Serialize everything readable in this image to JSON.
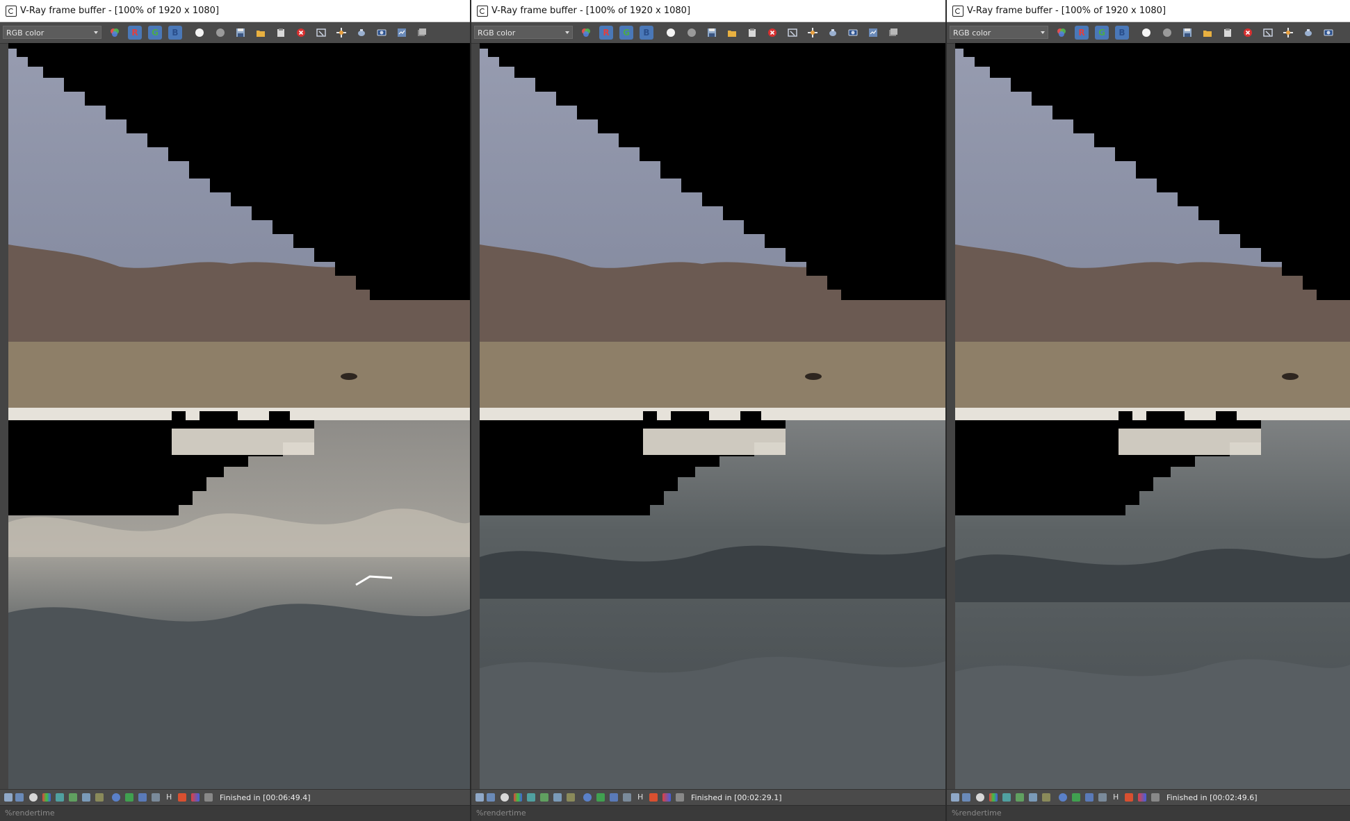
{
  "windows": [
    {
      "title": "V-Ray frame buffer - [100% of 1920 x 1080]",
      "channel": "RGB color",
      "status": "Finished in [00:06:49.4]",
      "info_placeholder": "%rendertime"
    },
    {
      "title": "V-Ray frame buffer - [100% of 1920 x 1080]",
      "channel": "RGB color",
      "status": "Finished in [00:02:29.1]",
      "info_placeholder": "%rendertime"
    },
    {
      "title": "V-Ray frame buffer - [100% of 1920 x 1080]",
      "channel": "RGB color",
      "status": "Finished in [00:02:49.6]",
      "info_placeholder": "%rendertime"
    }
  ],
  "channel_buttons": {
    "r": "R",
    "g": "G",
    "b": "B"
  },
  "colors": {
    "sky": "#8a91a6",
    "mountains": "#6e5a50",
    "sand": "#8f8068",
    "water": "#4a5054",
    "foam": "#d8d2c6",
    "unrendered": "#000000",
    "accent": "#4a78b8"
  }
}
